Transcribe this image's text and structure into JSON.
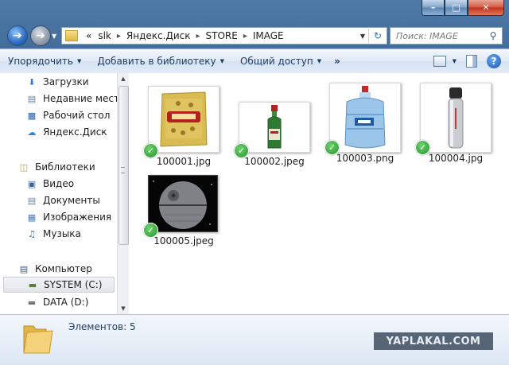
{
  "window": {
    "title": "",
    "controls": {
      "minimize_icon": "minimize-icon",
      "maximize_icon": "maximize-icon",
      "close_icon": "close-icon"
    }
  },
  "address": {
    "prefix": "«",
    "crumbs": [
      "slk",
      "Яндекс.Диск",
      "STORE",
      "IMAGE"
    ]
  },
  "search": {
    "placeholder": "Поиск: IMAGE"
  },
  "toolbar": {
    "organize": "Упорядочить",
    "add_to_library": "Добавить в библиотеку",
    "share": "Общий доступ",
    "more": "»"
  },
  "sidebar": {
    "favorites": [
      {
        "label": "Загрузки",
        "icon": "downloads-icon"
      },
      {
        "label": "Недавние места",
        "icon": "recent-places-icon"
      },
      {
        "label": "Рабочий стол",
        "icon": "desktop-icon"
      },
      {
        "label": "Яндекс.Диск",
        "icon": "yandex-disk-icon"
      }
    ],
    "libraries_header": "Библиотеки",
    "libraries": [
      {
        "label": "Видео",
        "icon": "video-icon"
      },
      {
        "label": "Документы",
        "icon": "documents-icon"
      },
      {
        "label": "Изображения",
        "icon": "pictures-icon"
      },
      {
        "label": "Музыка",
        "icon": "music-icon"
      }
    ],
    "computer_header": "Компьютер",
    "drives": [
      {
        "label": "SYSTEM (C:)",
        "icon": "system-drive-icon",
        "selected": true
      },
      {
        "label": "DATA (D:)",
        "icon": "data-drive-icon",
        "selected": false
      }
    ]
  },
  "files": [
    {
      "name": "100001.jpg",
      "thumb": "kozinak-package",
      "synced": true
    },
    {
      "name": "100002.jpeg",
      "thumb": "green-bottle",
      "synced": true
    },
    {
      "name": "100003.png",
      "thumb": "water-jug",
      "synced": true
    },
    {
      "name": "100004.jpg",
      "thumb": "thermos",
      "synced": true
    },
    {
      "name": "100005.jpeg",
      "thumb": "death-star",
      "synced": true
    }
  ],
  "status": {
    "item_count": "Элементов: 5"
  },
  "watermark": "YAPLAKAL.COM",
  "colors": {
    "accent": "#2b6bc0",
    "sync_ok": "#1f9a2a",
    "toolbar_text": "#1e3a5e"
  }
}
